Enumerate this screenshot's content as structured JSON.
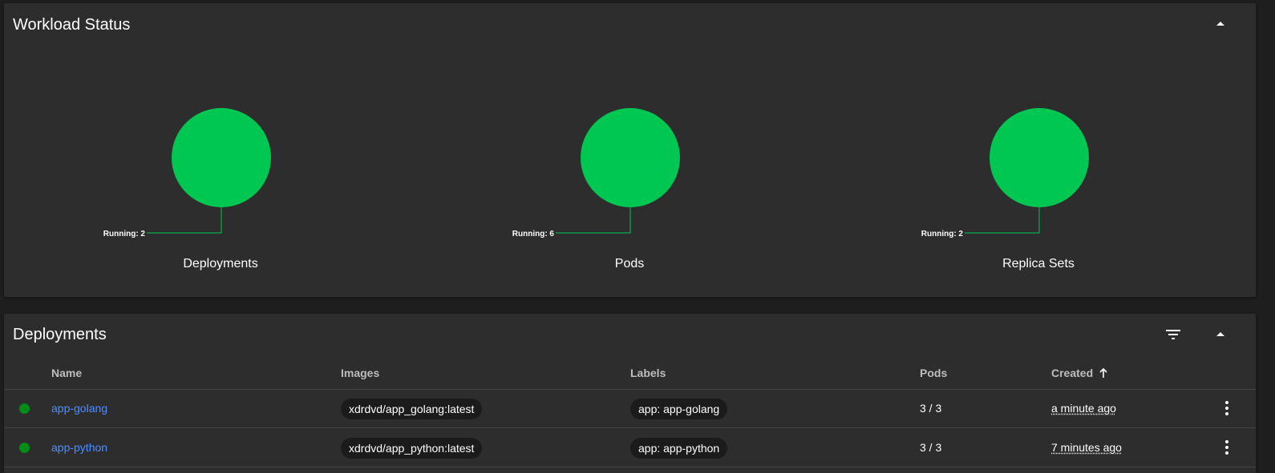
{
  "colors": {
    "background": "#1e1e1e",
    "card": "#2d2d2d",
    "running_green": "#00c752",
    "status_dot_green": "#008c17",
    "link_blue": "#4c8dff"
  },
  "workload_status": {
    "title": "Workload Status",
    "collapse_icon": "arrow-drop-up-icon",
    "graphs": [
      {
        "title": "Deployments",
        "label": "Running: 2",
        "running": 2
      },
      {
        "title": "Pods",
        "label": "Running: 6",
        "running": 6
      },
      {
        "title": "Replica Sets",
        "label": "Running: 2",
        "running": 2
      }
    ]
  },
  "deployments": {
    "title": "Deployments",
    "filter_icon": "filter-list-icon",
    "collapse_icon": "arrow-drop-up-icon",
    "columns": {
      "name": "Name",
      "images": "Images",
      "labels": "Labels",
      "pods": "Pods",
      "created": "Created"
    },
    "sort_icon": "arrow-upward-icon",
    "rows": [
      {
        "name": "app-golang",
        "image": "xdrdvd/app_golang:latest",
        "label": "app: app-golang",
        "pods": "3 / 3",
        "created": "a minute ago",
        "status": "running"
      },
      {
        "name": "app-python",
        "image": "xdrdvd/app_python:latest",
        "label": "app: app-python",
        "pods": "3 / 3",
        "created": "7 minutes ago",
        "status": "running"
      }
    ]
  }
}
